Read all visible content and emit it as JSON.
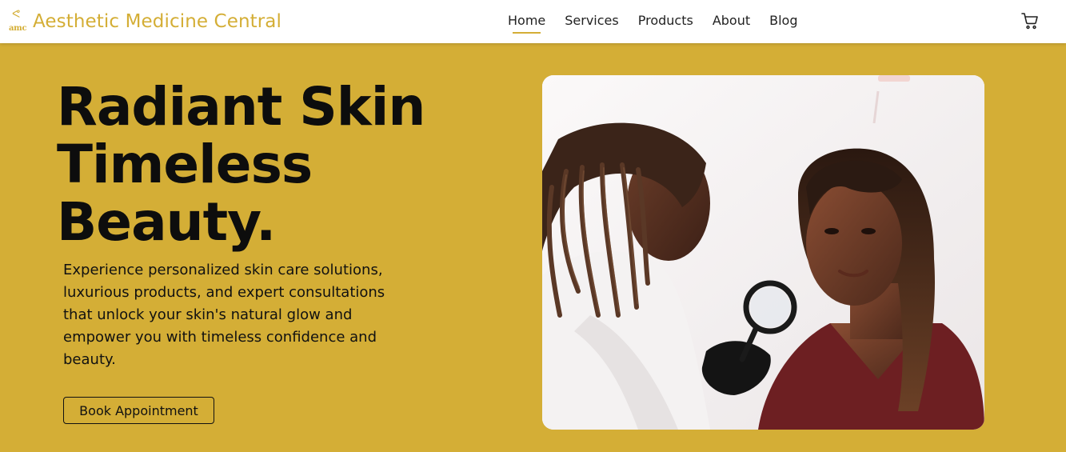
{
  "header": {
    "logo_text": "amc",
    "site_name": "Aesthetic Medicine Central",
    "nav": [
      {
        "label": "Home",
        "active": true
      },
      {
        "label": "Services",
        "active": false
      },
      {
        "label": "Products",
        "active": false
      },
      {
        "label": "About",
        "active": false
      },
      {
        "label": "Blog",
        "active": false
      }
    ],
    "cart_icon": "cart-icon"
  },
  "hero": {
    "title_lines": [
      "Radiant Skin",
      "Timeless",
      "Beauty."
    ],
    "description": "Experience personalized skin care solutions, luxurious products, and expert consultations that unlock your skin's natural glow and empower you with timeless confidence and beauty.",
    "cta_label": "Book Appointment",
    "image_subject": "dermatologist-examining-patient-photo"
  },
  "colors": {
    "brand": "#d4ae36",
    "background": "#d4ae36",
    "text": "#0d0d0d",
    "header_bg": "#ffffff"
  }
}
